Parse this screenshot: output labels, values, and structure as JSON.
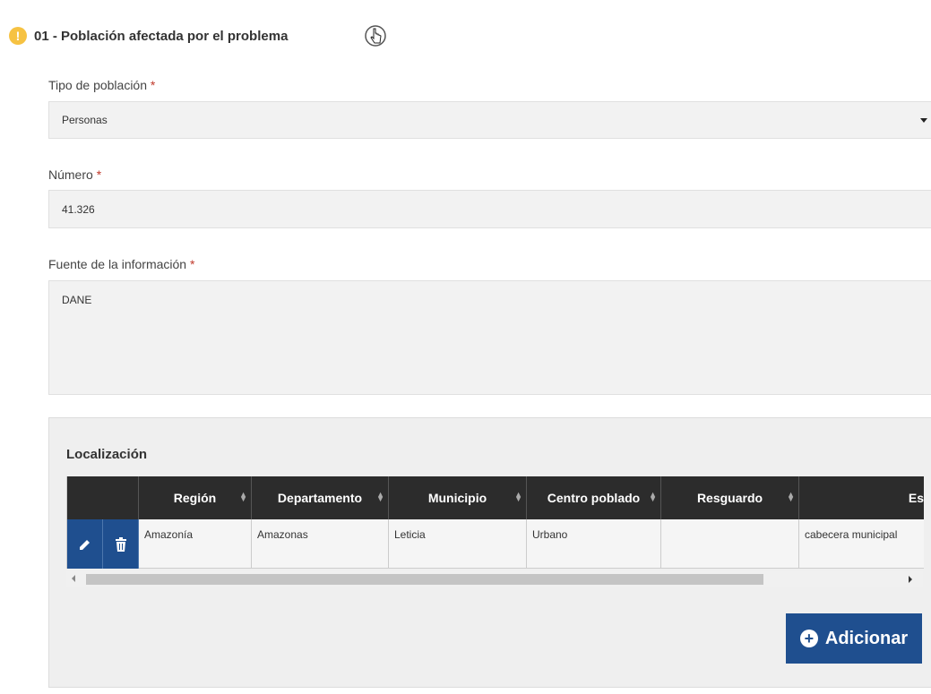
{
  "section": {
    "title": "01 - Población afectada por el problema",
    "warning_glyph": "!",
    "warning_icon": "warning-circle-icon",
    "cursor_icon": "hand-pointer-icon"
  },
  "tipo_poblacion": {
    "label": "Tipo de población",
    "required": "*",
    "value": "Personas",
    "caret_icon": "caret-down-icon"
  },
  "numero": {
    "label": "Número",
    "required": "*",
    "value": "41.326"
  },
  "fuente": {
    "label": "Fuente de la información",
    "required": "*",
    "value": "DANE"
  },
  "localizacion": {
    "title": "Localización",
    "columns": [
      "Región",
      "Departamento",
      "Municipio",
      "Centro poblado",
      "Resguardo",
      "Es"
    ],
    "rows": [
      {
        "region": "Amazonía",
        "departamento": "Amazonas",
        "municipio": "Leticia",
        "centro_poblado": "Urbano",
        "resguardo": "",
        "especifica": "cabecera municipal"
      }
    ],
    "edit_icon": "pencil-icon",
    "delete_icon": "trash-icon",
    "sort_icon": "sort-icon"
  },
  "add_button": {
    "label": "Adicionar",
    "icon": "plus-circle-icon"
  },
  "colors": {
    "accent": "#1f4f8f",
    "header_dark": "#2c2c2c",
    "warning": "#f6c242",
    "required": "#c0392b"
  }
}
